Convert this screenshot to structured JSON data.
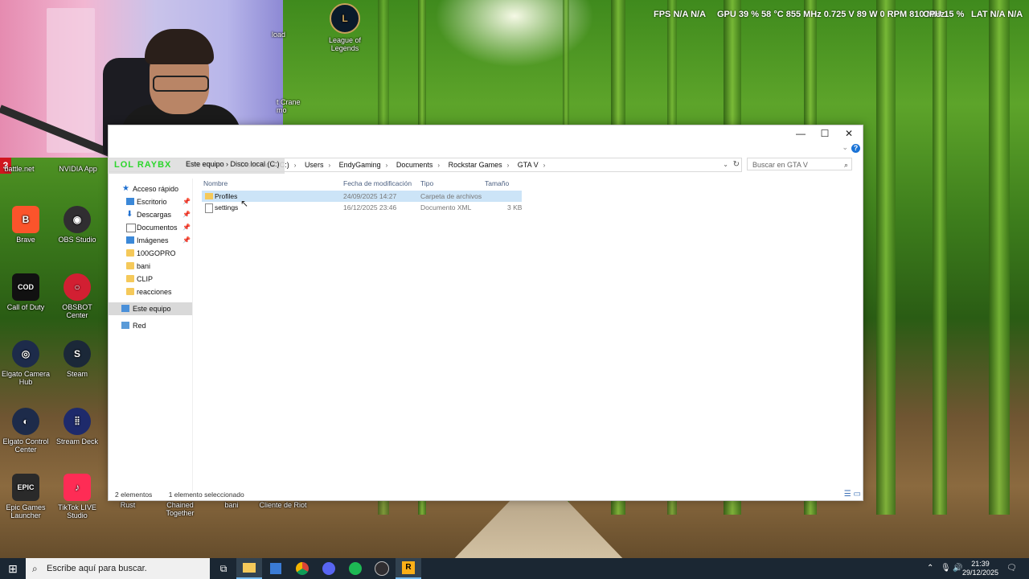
{
  "hud": {
    "fps_label": "FPS",
    "fps_value": "N/A",
    "gpu_label": "GPU",
    "gpu_value": "39 % 58 °C 855 MHz 0.725 V 89 W 0 RPM 810 MHz",
    "cpu_label": "CPU",
    "cpu_value": "15 %",
    "lat_label": "LAT",
    "lat_value": "N/A"
  },
  "stream": {
    "badge": "3",
    "tag": "LOL RAYBX"
  },
  "desktop": {
    "icons": [
      {
        "label": "Brave",
        "icon": "brave-icon",
        "color": "#fb542b"
      },
      {
        "label": "OBS Studio",
        "icon": "obs-icon",
        "color": "#302e31"
      },
      {
        "label": "Call of Duty",
        "icon": "cod-icon",
        "color": "#111111"
      },
      {
        "label": "OBSBOT Center",
        "icon": "obsbot-icon",
        "color": "#d21f32"
      },
      {
        "label": "Elgato Camera Hub",
        "icon": "elgato-camera-icon",
        "color": "#1d2b4a"
      },
      {
        "label": "Steam",
        "icon": "steam-icon",
        "color": "#1b2838"
      },
      {
        "label": "Elgato Control Center",
        "icon": "elgato-control-icon",
        "color": "#1d2b4a"
      },
      {
        "label": "Stream Deck",
        "icon": "stream-deck-icon",
        "color": "#1e2a6b"
      },
      {
        "label": "Epic Games Launcher",
        "icon": "epic-icon",
        "color": "#2a2a2a"
      },
      {
        "label": "TikTok LIVE Studio",
        "icon": "tiktok-icon",
        "color": "#fe2c55"
      },
      {
        "label": "League of Legends",
        "icon": "lol-icon",
        "color": "#0a1a2a"
      }
    ],
    "partial_labels": [
      "battle.net",
      "NVIDIA App",
      "load",
      "t Crane",
      "mo",
      "Rust",
      "Chained Together",
      "bani",
      "Cliente de Riot"
    ]
  },
  "explorer": {
    "window_controls": {
      "minimize": "—",
      "maximize": "☐",
      "close": "✕"
    },
    "breadcrumbs": [
      "Este equipo",
      "Disco local (C:)",
      "Users",
      "EndyGaming",
      "Documents",
      "Rockstar Games",
      "GTA V"
    ],
    "search_placeholder": "Buscar en GTA V",
    "nav": {
      "quick_access": "Acceso rápido",
      "items": [
        {
          "label": "Escritorio",
          "pinned": true
        },
        {
          "label": "Descargas",
          "pinned": true
        },
        {
          "label": "Documentos",
          "pinned": true
        },
        {
          "label": "Imágenes",
          "pinned": true
        },
        {
          "label": "100GOPRO",
          "pinned": false
        },
        {
          "label": "bani",
          "pinned": false
        },
        {
          "label": "CLIP",
          "pinned": false
        },
        {
          "label": "reacciones",
          "pinned": false
        }
      ],
      "this_pc": "Este equipo",
      "network": "Red"
    },
    "columns": [
      "Nombre",
      "Fecha de modificación",
      "Tipo",
      "Tamaño"
    ],
    "files": [
      {
        "name": "Profiles",
        "date": "24/09/2025 14:27",
        "type": "Carpeta de archivos",
        "size": "",
        "selected": true
      },
      {
        "name": "settings",
        "date": "16/12/2025 23:46",
        "type": "Documento XML",
        "size": "3 KB",
        "selected": false
      }
    ],
    "status_count": "2 elementos",
    "status_selected": "1 elemento seleccionado"
  },
  "taskbar": {
    "search_placeholder": "Escribe aquí para buscar.",
    "time": "21:39",
    "date": "29/12/2025"
  }
}
